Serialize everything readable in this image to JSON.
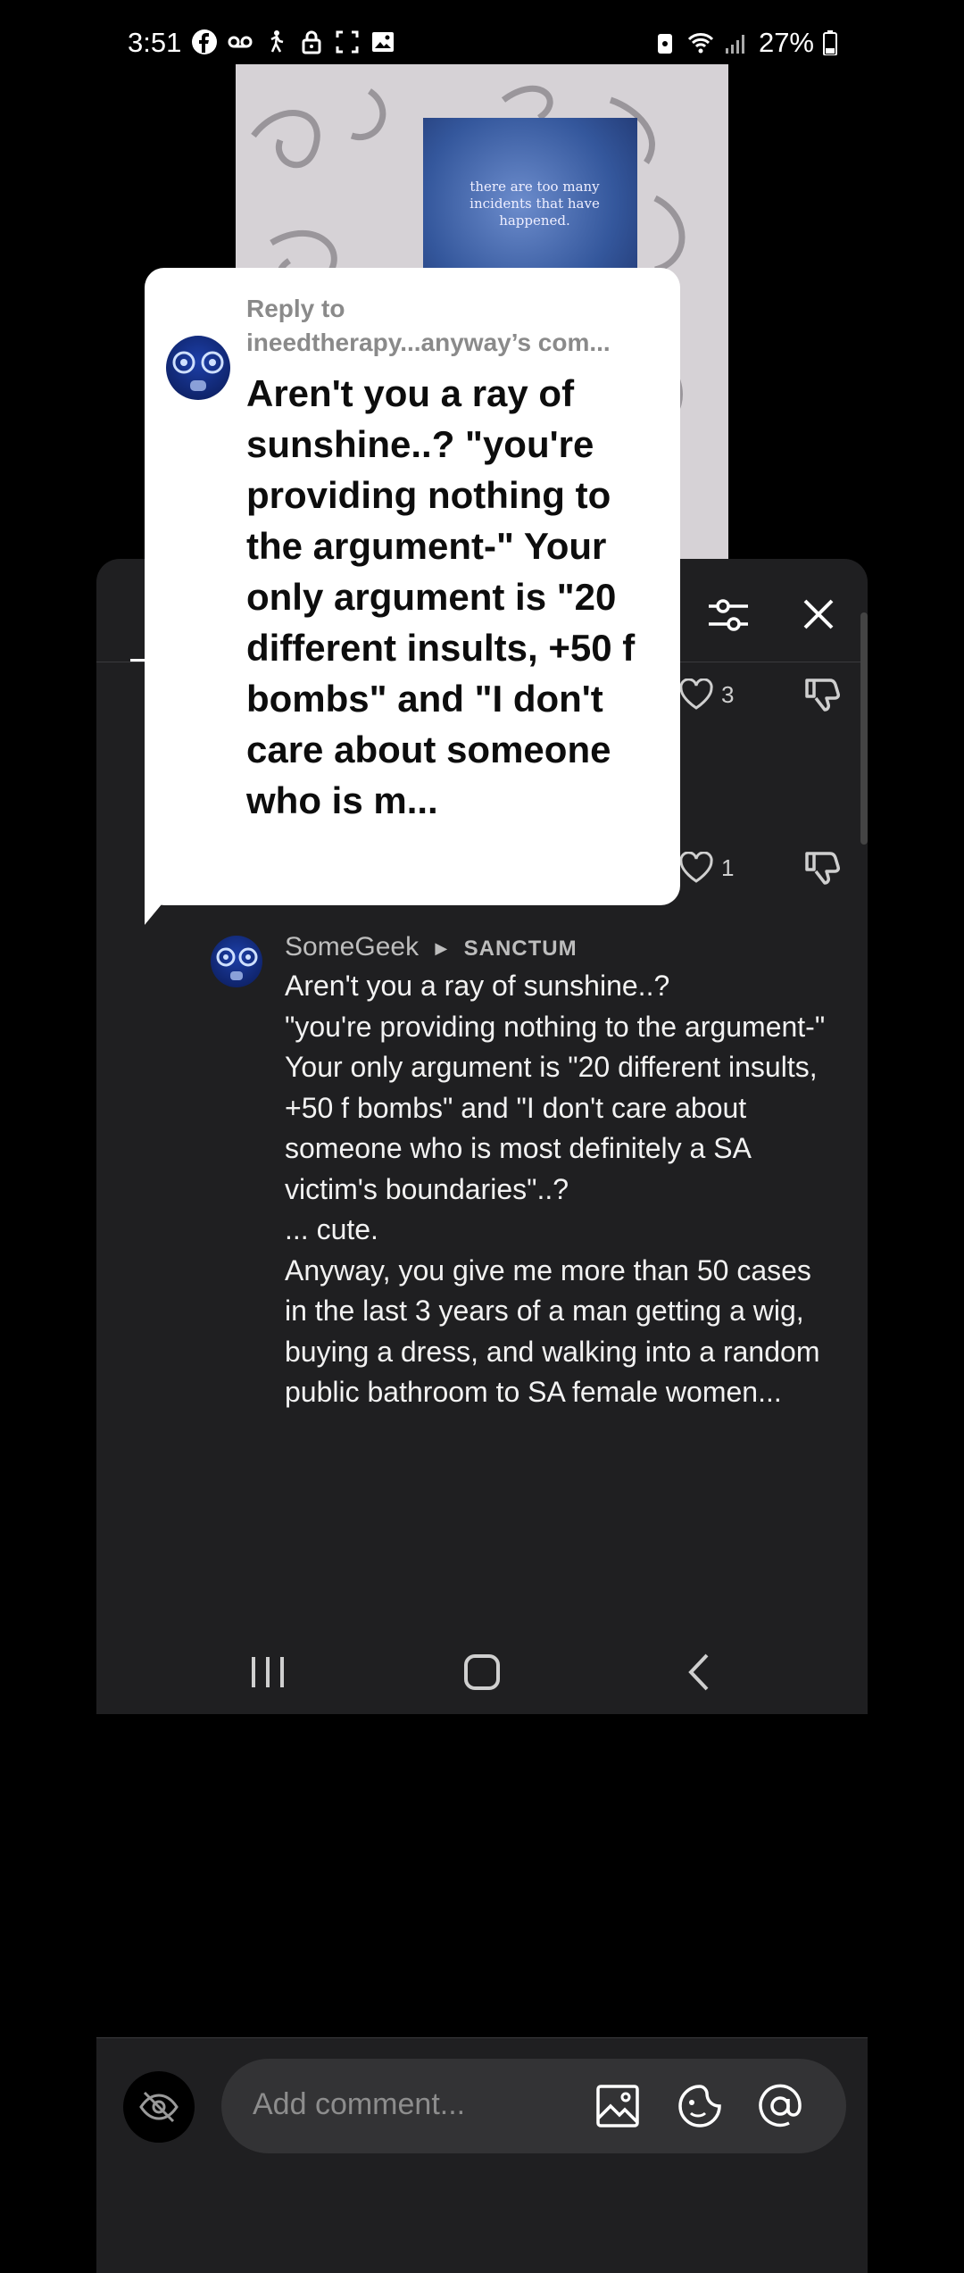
{
  "status_bar": {
    "time": "3:51",
    "battery": "27%"
  },
  "video": {
    "caption": "there are too many incidents that have happened."
  },
  "comments": {
    "likes_1": "3",
    "likes_2": "1",
    "author": "SomeGeek",
    "author_tag": "SANCTUM",
    "body": "Aren't you a ray of sunshine..?\n\"you're providing nothing to the argument-\" Your only argument is \"20 different insults, +50 f bombs\" and \"I don't care about someone who is most definitely a SA victim's boundaries\"..?\n... cute.\nAnyway, you give me more than 50 cases in the last 3 years of a man getting a wig, buying a dress, and walking into a random public bathroom to SA female women..."
  },
  "input": {
    "placeholder": "Add comment..."
  },
  "popup": {
    "reply_label": "Reply to",
    "reply_target": "ineedtherapy...anyway’s com...",
    "text": "Aren't you a ray of sunshine..? \"you're providing nothing to the argument-\" Your only argument is \"20 different insults, +50 f bombs\" and \"I don't care about someone who is m..."
  },
  "colors": {
    "sheet_bg": "#1f1f21",
    "accent": "#ffffff"
  }
}
